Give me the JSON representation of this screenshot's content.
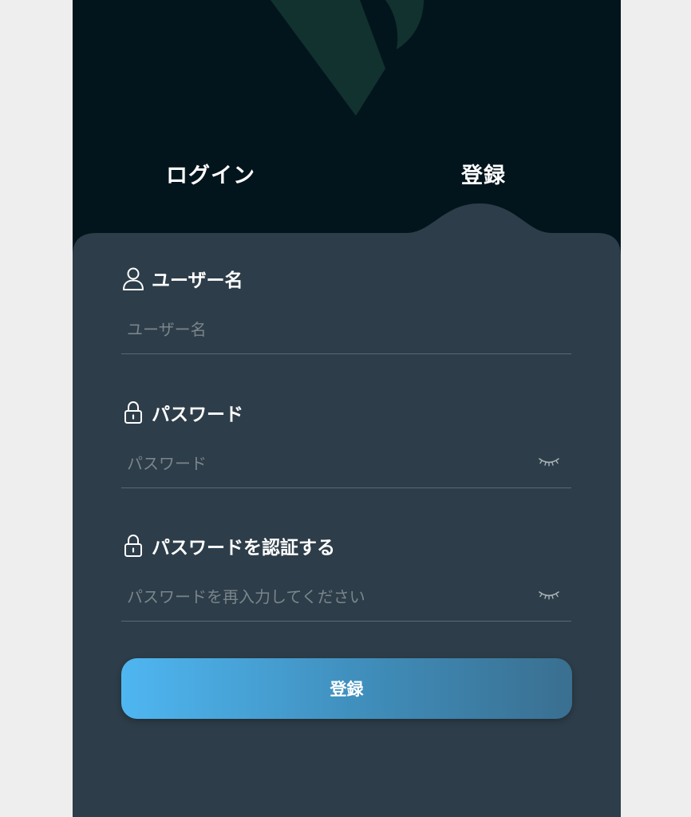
{
  "colors": {
    "header_background": "#03151c",
    "card_background": "#2d3d49",
    "logo_color": "#12322f",
    "button_gradient_start": "#4fb6f1",
    "button_gradient_end": "#3a6f90",
    "placeholder": "#7a858c",
    "divider": "#5b6a74"
  },
  "tabs": {
    "login": "ログイン",
    "register": "登録",
    "active": "register"
  },
  "fields": {
    "username": {
      "label": "ユーザー名",
      "placeholder": "ユーザー名",
      "value": "",
      "icon": "user-icon"
    },
    "password": {
      "label": "パスワード",
      "placeholder": "パスワード",
      "value": "",
      "icon": "lock-icon",
      "toggle_icon": "eye-closed-icon"
    },
    "confirm_password": {
      "label": "パスワードを認証する",
      "placeholder": "パスワードを再入力してください",
      "value": "",
      "icon": "lock-icon",
      "toggle_icon": "eye-closed-icon"
    }
  },
  "submit": {
    "label": "登録"
  }
}
